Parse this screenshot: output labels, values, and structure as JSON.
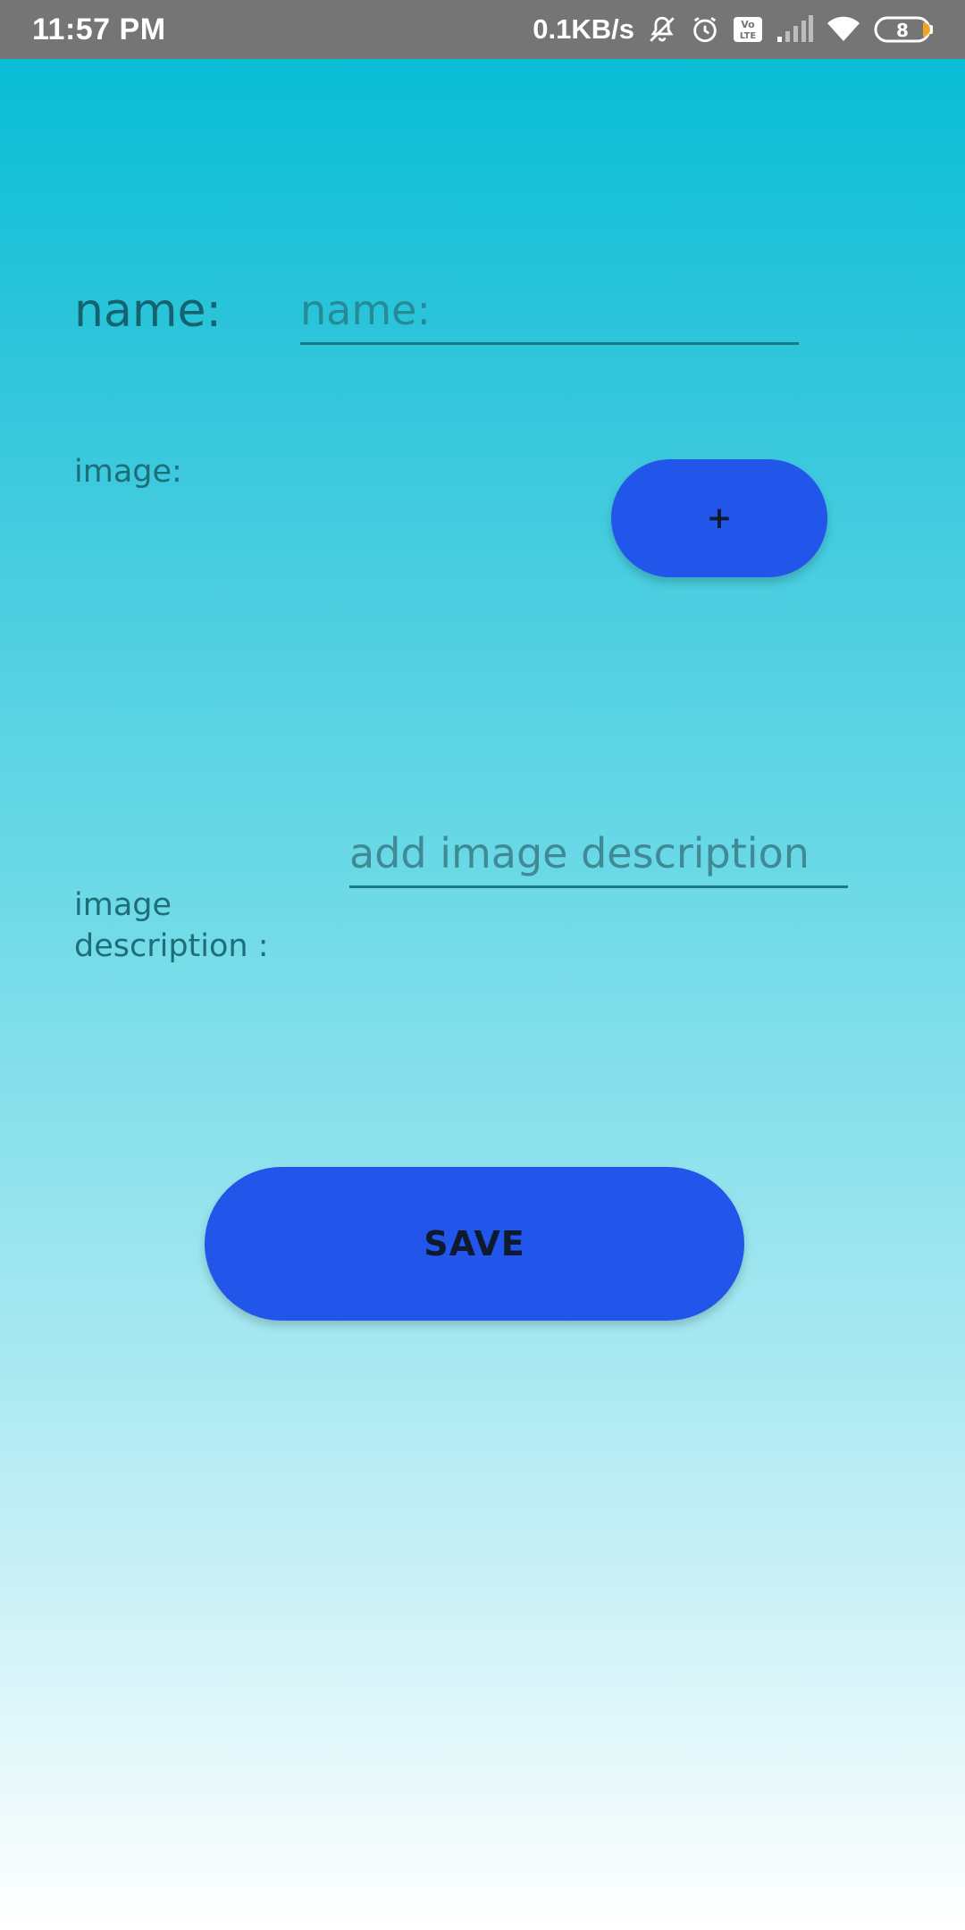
{
  "status_bar": {
    "time": "11:57 PM",
    "network_speed": "0.1KB/s",
    "battery_level": "8",
    "icons": [
      "mute-bell-icon",
      "alarm-clock-icon",
      "volte-icon",
      "signal-icon",
      "wifi-icon",
      "battery-icon"
    ]
  },
  "form": {
    "name_label": "name:",
    "name_input": {
      "value": "",
      "placeholder": "name:"
    },
    "image_label": "image:",
    "add_image_button": "+",
    "image_description_label": "image description :",
    "image_description_input": {
      "value": "",
      "placeholder": "add image description"
    },
    "save_button": "SAVE"
  },
  "colors": {
    "status_bar": "#757575",
    "gradient_top": "#00bcd4",
    "gradient_bottom": "#ffffff",
    "button": "#2255ea",
    "label_text": "#1d6e79"
  }
}
